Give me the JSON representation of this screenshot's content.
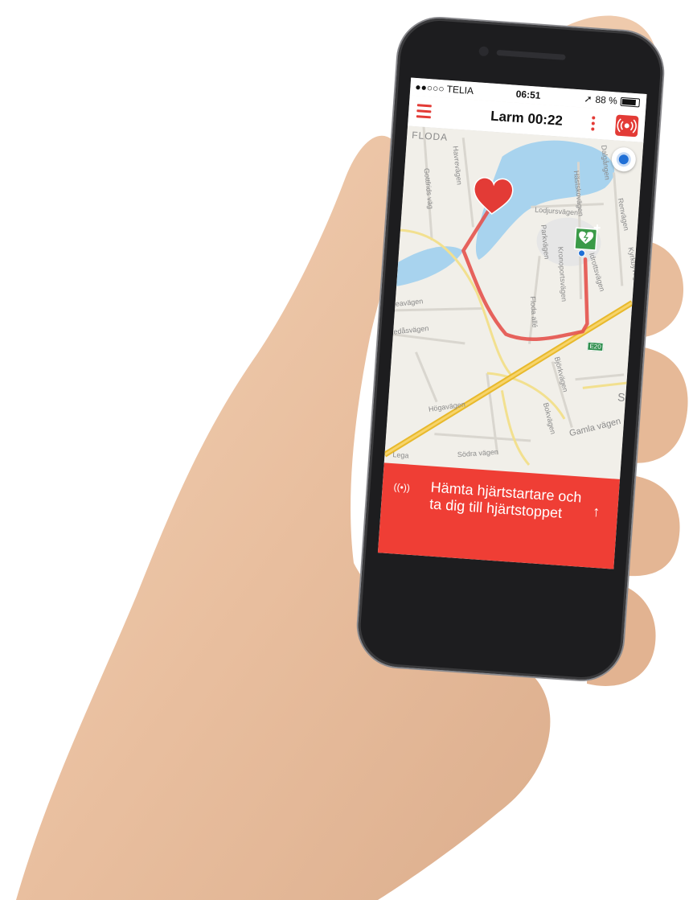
{
  "status_bar": {
    "carrier": "●●○○○ TELIA",
    "time": "06:51",
    "battery": "88 %"
  },
  "header": {
    "title": "Larm 00:22"
  },
  "map": {
    "labels": {
      "floda": "FLODA",
      "havrevagen": "Havrevägen",
      "gottfrids": "Gottfrids väg",
      "lodjursvagen": "Lodjursvägen",
      "hastskovagen": "Hästskovägen",
      "dalgangen": "Dalgången",
      "renvagen": "Renvägen",
      "kyrkbyvagen": "Kyrkbyvägen",
      "parkvagen": "Parkvägen",
      "kronoportsvagen": "Kronoportsvägen",
      "floda_alle": "Floda allé",
      "idrottsvagen": "Idrottsvägen",
      "eavagen": "eavägen",
      "edasvagen": "edåsvägen",
      "bjorkvagen": "Björkvägen",
      "bokvagen": "Bokvägen",
      "gamla_vagen": "Gamla vägen",
      "hogavagen": "Högavägen",
      "sodra_vagen": "Södra vägen",
      "lega": "Lega",
      "s_label": "S",
      "e20": "E20"
    },
    "colors": {
      "water": "#a8d3ee",
      "route": "#e4524d",
      "highway": "#e8b92c",
      "aed": "#3a9a48"
    }
  },
  "banner": {
    "text": "Hämta hjärtstartare och ta dig till hjärtstoppet",
    "signal_icon": "((•))",
    "arrow_icon": "↑"
  },
  "icons": {
    "menu": "menu-icon",
    "more": "more-vertical-icon",
    "alarm": "alarm-signal-icon",
    "locate": "locate-icon",
    "heart": "heart-icon",
    "aed": "aed-defibrillator-icon"
  }
}
